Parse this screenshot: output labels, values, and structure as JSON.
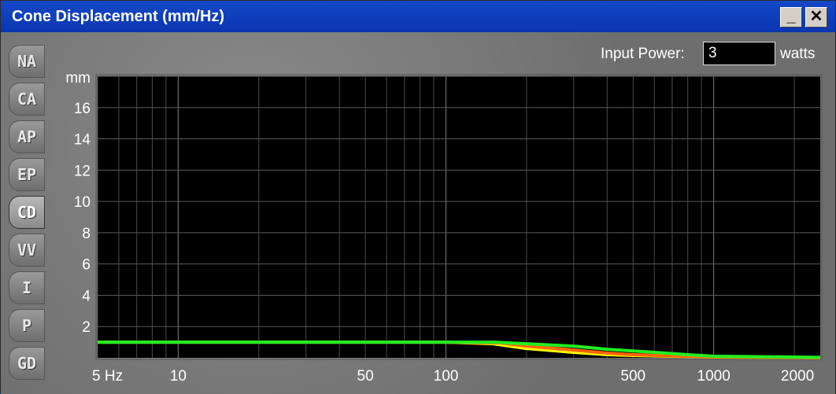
{
  "window": {
    "title": "Cone Displacement (mm/Hz)",
    "minimize_label": "_",
    "close_label": "✕"
  },
  "tabs": [
    {
      "label": "NA",
      "active": false
    },
    {
      "label": "CA",
      "active": false
    },
    {
      "label": "AP",
      "active": false
    },
    {
      "label": "EP",
      "active": false
    },
    {
      "label": "CD",
      "active": true
    },
    {
      "label": "VV",
      "active": false
    },
    {
      "label": "I",
      "active": false
    },
    {
      "label": "P",
      "active": false
    },
    {
      "label": "GD",
      "active": false
    }
  ],
  "input_power": {
    "label": "Input Power:",
    "value": "3",
    "unit": "watts"
  },
  "chart_data": {
    "type": "line",
    "ylabel": "mm",
    "y_ticks": [
      2,
      4,
      6,
      8,
      10,
      12,
      14,
      16
    ],
    "ylim": [
      0,
      18
    ],
    "x_scale": "log",
    "xlim": [
      5,
      2500
    ],
    "x_ticks": [
      {
        "value": 5,
        "label": "5 Hz"
      },
      {
        "value": 10,
        "label": "10"
      },
      {
        "value": 50,
        "label": "50"
      },
      {
        "value": 100,
        "label": "100"
      },
      {
        "value": 500,
        "label": "500"
      },
      {
        "value": 1000,
        "label": "1000"
      },
      {
        "value": 2000,
        "label": "2000"
      }
    ],
    "grid": true,
    "background": "#000000",
    "series": [
      {
        "color": "#ffff00",
        "x": [
          5,
          100,
          150,
          200,
          300,
          400,
          500,
          700,
          1000,
          2000,
          2500
        ],
        "y": [
          1.0,
          1.0,
          0.9,
          0.6,
          0.35,
          0.2,
          0.15,
          0.1,
          0.05,
          0.02,
          0.0
        ]
      },
      {
        "color": "#ff6600",
        "x": [
          5,
          100,
          160,
          200,
          300,
          400,
          500,
          700,
          1000,
          2000,
          2500
        ],
        "y": [
          1.0,
          1.0,
          0.95,
          0.75,
          0.5,
          0.3,
          0.2,
          0.12,
          0.06,
          0.03,
          0.0
        ]
      },
      {
        "color": "#22ee22",
        "x": [
          5,
          100,
          150,
          200,
          300,
          400,
          600,
          800,
          1000,
          2000,
          2500
        ],
        "y": [
          1.0,
          1.0,
          1.0,
          0.9,
          0.75,
          0.55,
          0.35,
          0.2,
          0.1,
          0.05,
          0.03
        ]
      }
    ]
  }
}
